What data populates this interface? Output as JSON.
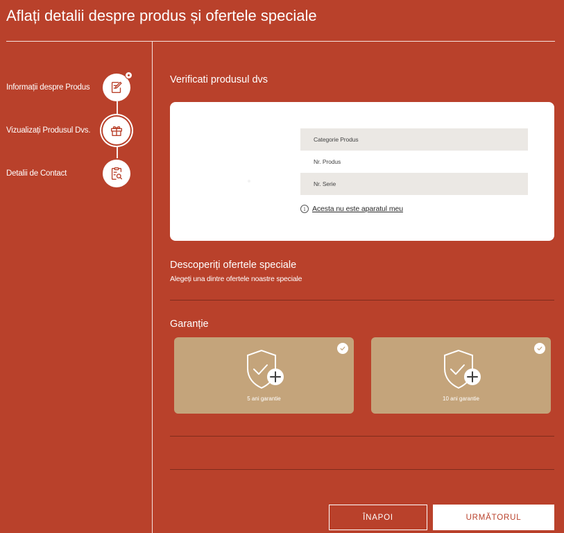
{
  "page": {
    "title": "Aflați detalii despre produs și ofertele speciale"
  },
  "sidebar": {
    "steps": [
      {
        "label": "Informații despre Produs",
        "icon": "edit-document-icon"
      },
      {
        "label": "Vizualizați Produsul Dvs.",
        "icon": "gift-icon",
        "active": true
      },
      {
        "label": "Detalii de Contact",
        "icon": "search-document-icon"
      }
    ]
  },
  "verify": {
    "title": "Verificati produsul dvs",
    "fields": [
      {
        "label": "Categorie Produs"
      },
      {
        "label": "Nr. Produs"
      },
      {
        "label": "Nr. Serie"
      }
    ],
    "not_mine_icon": "i",
    "not_mine_link": "Acesta nu este aparatul meu"
  },
  "offers": {
    "title": "Descoperiți ofertele speciale",
    "subtitle": "Alegeți una dintre ofertele noastre speciale"
  },
  "warranty": {
    "title": "Garanție",
    "options": [
      {
        "label": "5 ani garantie",
        "icon": "shield-plus-icon",
        "checked": false
      },
      {
        "label": "10 ani garantie",
        "icon": "shield-plus-icon",
        "checked": false
      }
    ]
  },
  "footer": {
    "back_label": "ÎNAPOI",
    "next_label": "URMĂTORUL"
  },
  "colors": {
    "background": "#b9412b",
    "card": "#ffffff",
    "field_shade": "#ebe8e4",
    "warranty_card": "#c4a47b"
  }
}
